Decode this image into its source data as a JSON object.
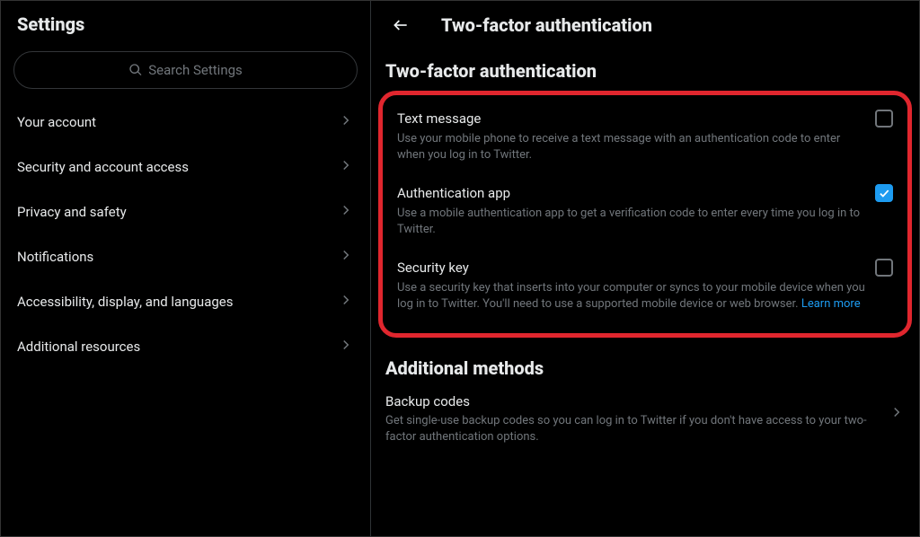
{
  "sidebar": {
    "title": "Settings",
    "search_placeholder": "Search Settings",
    "items": [
      {
        "label": "Your account"
      },
      {
        "label": "Security and account access"
      },
      {
        "label": "Privacy and safety"
      },
      {
        "label": "Notifications"
      },
      {
        "label": "Accessibility, display, and languages"
      },
      {
        "label": "Additional resources"
      }
    ]
  },
  "main": {
    "header_title": "Two-factor authentication",
    "section_heading": "Two-factor authentication",
    "options": {
      "text_message": {
        "title": "Text message",
        "desc": "Use your mobile phone to receive a text message with an authentication code to enter when you log in to Twitter.",
        "checked": false
      },
      "auth_app": {
        "title": "Authentication app",
        "desc": "Use a mobile authentication app to get a verification code to enter every time you log in to Twitter.",
        "checked": true
      },
      "security_key": {
        "title": "Security key",
        "desc": "Use a security key that inserts into your computer or syncs to your mobile device when you log in to Twitter. You'll need to use a supported mobile device or web browser. ",
        "learn_more": "Learn more",
        "checked": false
      }
    },
    "additional_heading": "Additional methods",
    "backup_codes": {
      "title": "Backup codes",
      "desc": "Get single-use backup codes so you can log in to Twitter if you don't have access to your two-factor authentication options."
    }
  }
}
